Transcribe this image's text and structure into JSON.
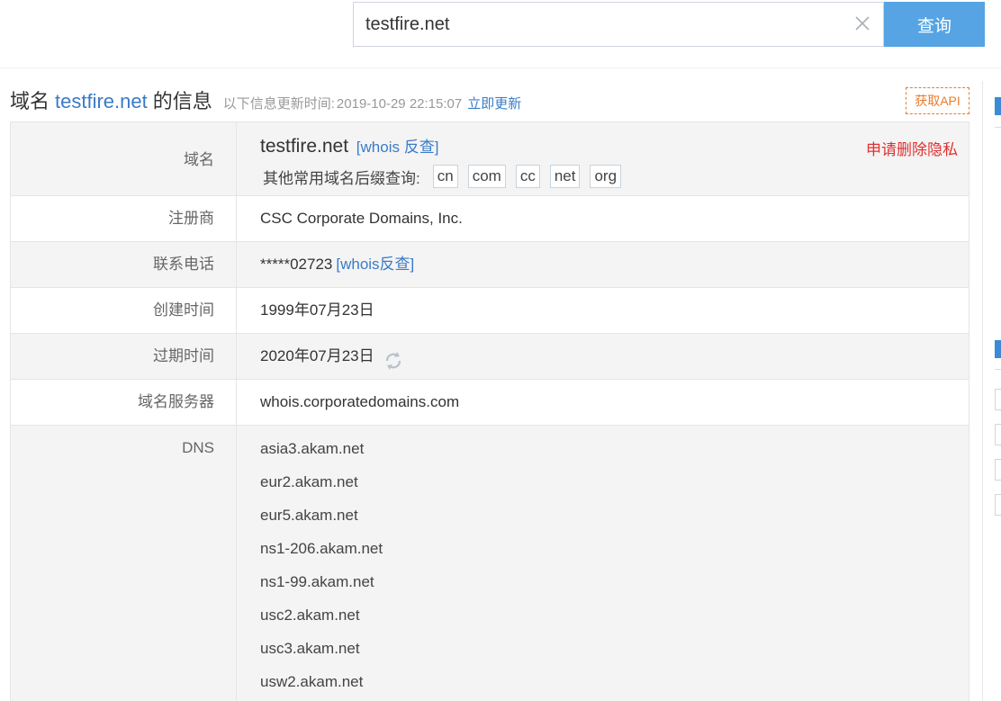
{
  "search": {
    "value": "testfire.net",
    "button_label": "查询"
  },
  "header": {
    "title_prefix": "域名",
    "title_domain": "testfire.net",
    "title_suffix": "的信息",
    "update_label": "以下信息更新时间:",
    "update_time": "2019-10-29 22:15:07",
    "update_now": "立即更新",
    "api_button": "获取API"
  },
  "rows": {
    "domain": {
      "label": "域名",
      "value": "testfire.net",
      "whois_link": "[whois 反查]",
      "privacy_link": "申请删除隐私",
      "suffix_label": "其他常用域名后缀查询:",
      "suffixes": [
        "cn",
        "com",
        "cc",
        "net",
        "org"
      ]
    },
    "registrar": {
      "label": "注册商",
      "value": "CSC Corporate Domains, Inc."
    },
    "phone": {
      "label": "联系电话",
      "value": "*****02723",
      "link": "[whois反查]"
    },
    "created": {
      "label": "创建时间",
      "value": "1999年07月23日"
    },
    "expires": {
      "label": "过期时间",
      "value": "2020年07月23日"
    },
    "whois_server": {
      "label": "域名服务器",
      "value": "whois.corporatedomains.com"
    },
    "dns": {
      "label": "DNS",
      "servers": [
        "asia3.akam.net",
        "eur2.akam.net",
        "eur5.akam.net",
        "ns1-206.akam.net",
        "ns1-99.akam.net",
        "usc2.akam.net",
        "usc3.akam.net",
        "usw2.akam.net"
      ]
    }
  },
  "colors": {
    "accent": "#56a4e3",
    "link": "#3a7bc8",
    "danger": "#e03030",
    "api": "#e87c2b"
  }
}
